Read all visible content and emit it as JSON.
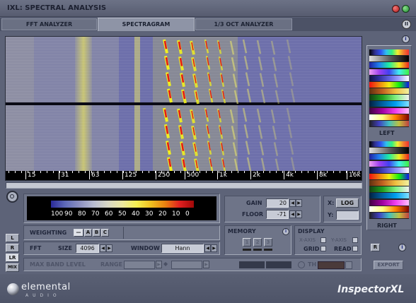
{
  "window": {
    "title": "IXL: SPECTRAL ANALYSIS"
  },
  "tabs": [
    {
      "label": "FFT ANALYZER"
    },
    {
      "label": "SPECTRAGRAM"
    },
    {
      "label": "1/3 OCT ANALYZER"
    }
  ],
  "info_icon": "i",
  "freq_axis": {
    "labels": [
      "15",
      "31",
      "63",
      "125",
      "250",
      "500",
      "1k",
      "2k",
      "4k",
      "8k",
      "16k"
    ]
  },
  "scale": {
    "labels": [
      "100",
      "90",
      "80",
      "70",
      "60",
      "50",
      "40",
      "30",
      "20",
      "10",
      "0"
    ]
  },
  "gain": {
    "label": "GAIN",
    "value": "20"
  },
  "floor": {
    "label": "FLOOR",
    "value": "-71"
  },
  "xaxis": {
    "label": "X:",
    "value": "LOG"
  },
  "yaxis": {
    "label": "Y:",
    "value": ""
  },
  "channels": {
    "left": "LEFT",
    "right": "RIGHT",
    "r_button": "R",
    "buttons": [
      "L",
      "R",
      "LR",
      "MIX"
    ]
  },
  "weighting": {
    "label": "WEIGHTING",
    "options": [
      "—",
      "A",
      "B",
      "C"
    ]
  },
  "memory": {
    "label": "MEMORY",
    "slots": [
      "1",
      "2",
      "3"
    ]
  },
  "display": {
    "label": "DISPLAY",
    "x_axis": "X-AXIS",
    "y_axis": "Y-AXIS",
    "grid": "GRID",
    "read": "READ"
  },
  "fft": {
    "label": "FFT",
    "size_label": "SIZE",
    "size_value": "4096",
    "window_label": "WINDOW",
    "window_value": "Hann"
  },
  "max_band": {
    "label": "MAX BAND LEVEL",
    "range_label": "RANGE",
    "th_label": "TH"
  },
  "export_label": "EXPORT",
  "brand": {
    "company": "elemental",
    "sub": "AUDIO",
    "product": "InspectorXL"
  },
  "colors": {
    "spec_bg": "#6d6faa",
    "hot": "#e81818",
    "warm": "#f0f020"
  }
}
